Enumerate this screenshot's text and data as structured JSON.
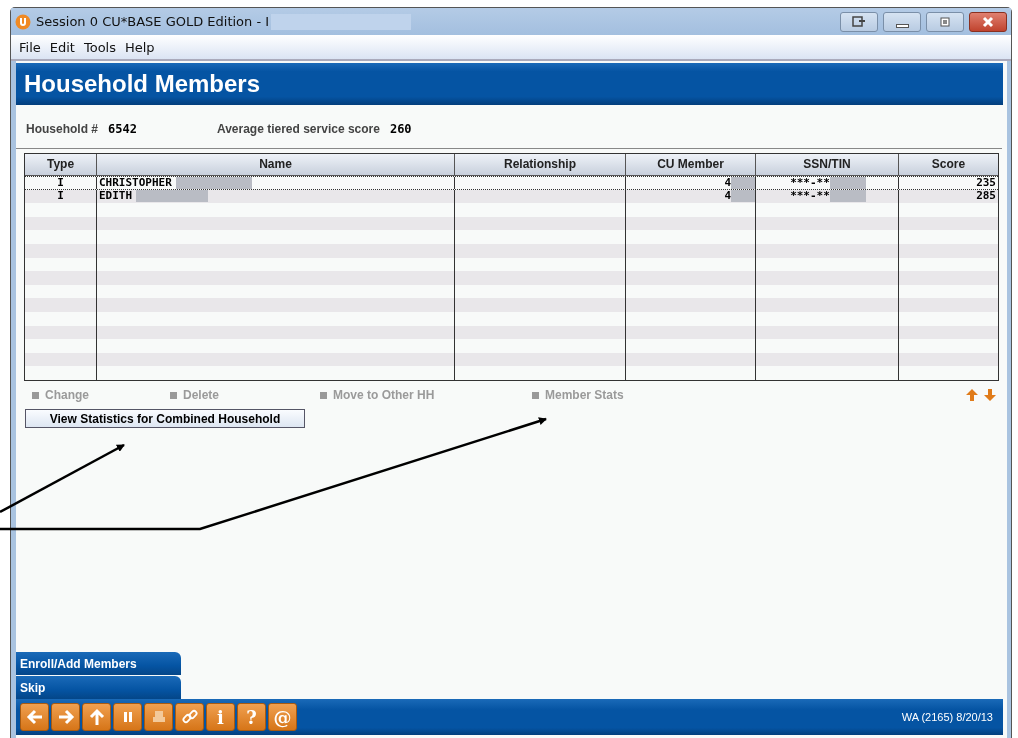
{
  "window": {
    "title": "Session 0 CU*BASE GOLD Edition - I"
  },
  "menu": [
    "File",
    "Edit",
    "Tools",
    "Help"
  ],
  "header": {
    "title": "Household Members"
  },
  "info": [
    {
      "label": "Household #",
      "value": "6542"
    },
    {
      "label": "Average tiered service score",
      "value": "260"
    }
  ],
  "table": {
    "columns": [
      "Type",
      "Name",
      "Relationship",
      "CU Member",
      "SSN/TIN",
      "Score"
    ],
    "rows": [
      {
        "selected": true,
        "cells": [
          "I",
          "CHRISTOPHER",
          "",
          "4",
          "***-**",
          "235"
        ]
      },
      {
        "selected": false,
        "cells": [
          "I",
          "EDITH",
          "",
          "4",
          "***-**",
          "285"
        ]
      }
    ]
  },
  "actions": [
    {
      "label": "Change",
      "disabled": true
    },
    {
      "label": "Delete",
      "disabled": true
    },
    {
      "label": "Move to Other HH",
      "disabled": true
    },
    {
      "label": "Member Stats",
      "disabled": true
    }
  ],
  "view_button": {
    "label": "View Statistics for Combined Household"
  },
  "side_buttons": [
    "Enroll/Add Members",
    "Skip"
  ],
  "toolbar": [
    {
      "kind": "back"
    },
    {
      "kind": "forward"
    },
    {
      "kind": "up"
    },
    {
      "kind": "pause"
    },
    {
      "kind": "print"
    },
    {
      "kind": "link"
    },
    {
      "kind": "text",
      "label": "i"
    },
    {
      "kind": "text",
      "label": "?"
    },
    {
      "kind": "text",
      "label": "@"
    }
  ],
  "status": "WA (2165) 8/20/13"
}
